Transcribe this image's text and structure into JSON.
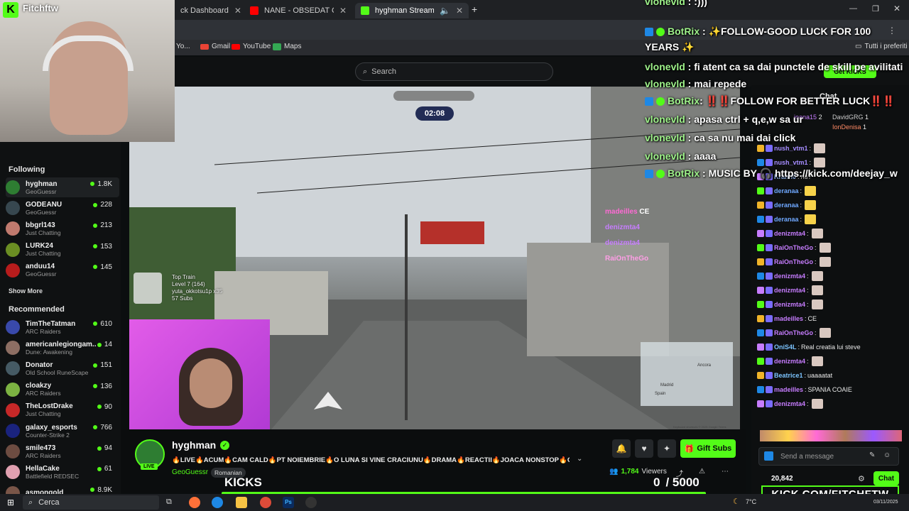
{
  "browser": {
    "tabs": [
      {
        "label": "ck Dashboard",
        "icon": "kick-favicon"
      },
      {
        "label": "NANE - OBSEDAT CA CENTRAL",
        "icon": "youtube-favicon"
      },
      {
        "label": "hyghman Stream - Watch L",
        "icon": "kick-favicon",
        "active": true
      }
    ],
    "new_tab": "+",
    "bookmarks": [
      "Yo...",
      "Gmail",
      "YouTube",
      "Maps"
    ],
    "all_bookmarks": "Tutti i preferiti"
  },
  "webcam_channel": "Fitchftw",
  "search": {
    "placeholder": "Search"
  },
  "sidebar": {
    "following_title": "Following",
    "following": [
      {
        "name": "hyghman",
        "game": "GeoGuessr",
        "viewers": "1.8K",
        "color": "#2e7d32"
      },
      {
        "name": "GODEANU",
        "game": "GeoGuessr",
        "viewers": "228",
        "color": "#37474f"
      },
      {
        "name": "bbgrl143",
        "game": "Just Chatting",
        "viewers": "213",
        "color": "#c07a6e"
      },
      {
        "name": "LURK24",
        "game": "Just Chatting",
        "viewers": "153",
        "color": "#6b8e23"
      },
      {
        "name": "anduu14",
        "game": "GeoGuessr",
        "viewers": "145",
        "color": "#b71c1c"
      }
    ],
    "show_more": "Show More",
    "recommended_title": "Recommended",
    "recommended": [
      {
        "name": "TimTheTatman",
        "game": "ARC Raiders",
        "viewers": "610",
        "color": "#3949ab"
      },
      {
        "name": "americanlegiongam...",
        "game": "Dune: Awakening",
        "viewers": "14",
        "color": "#8d6e63"
      },
      {
        "name": "Donator",
        "game": "Old School RuneScape",
        "viewers": "151",
        "color": "#455a64"
      },
      {
        "name": "cloakzy",
        "game": "ARC Raiders",
        "viewers": "136",
        "color": "#7cb342"
      },
      {
        "name": "TheLostDrake",
        "game": "Just Chatting",
        "viewers": "90",
        "color": "#c62828"
      },
      {
        "name": "galaxy_esports",
        "game": "Counter-Strike 2",
        "viewers": "766",
        "color": "#1a237e"
      },
      {
        "name": "smile473",
        "game": "ARC Raiders",
        "viewers": "94",
        "color": "#6d4c41"
      },
      {
        "name": "HellaCake",
        "game": "Battlefield REDSEC",
        "viewers": "61",
        "color": "#e0a0b0"
      },
      {
        "name": "asmongold",
        "game": "",
        "viewers": "8.9K",
        "color": "#795548"
      }
    ]
  },
  "video": {
    "timer": "02:08",
    "train_overlay": {
      "title": "Top Train",
      "level": "Level 7 (164)",
      "user": "yuta_okkotsu1p x35",
      "subs": "57 Subs"
    },
    "map_labels": [
      "Ancora",
      "Spain",
      "Madrid"
    ],
    "copyright": "Keyboard shortcuts © 2025 Google Terms"
  },
  "stream_info": {
    "streamer": "hyghman",
    "live": "LIVE",
    "title": "🔥LIVE🔥ACUM🔥CAM CALD🔥PT NOIEMBRIE🔥O LUNA SI VINE CRACIUNU🔥DRAMA🔥REACTII🔥JOACA NONSTOP🔥OBS...",
    "category": "GeoGuessr",
    "tag": "Romanian",
    "viewers": "1,784",
    "viewers_label": "Viewers",
    "gift_subs": "Gift Subs"
  },
  "kicks_bar": {
    "label": "KICKS",
    "current": "0",
    "goal": "/ 5000"
  },
  "overlay_chat": [
    {
      "user": "vlonevld",
      "text": " : :)))",
      "color": "#9ef28a"
    },
    {
      "user": "BotRix",
      "text": " : ✨FOLLOW-GOOD LUCK FOR 100",
      "color": "#9ef28a"
    },
    {
      "user": "",
      "text": "YEARS ✨",
      "color": "#fff"
    },
    {
      "user": "vlonevld",
      "text": " : fi atent ca sa dai punctele de skill pe avilitati",
      "color": "#9ef28a"
    },
    {
      "user": "vlonevld",
      "text": " : mai repede",
      "color": "#9ef28a"
    },
    {
      "user": "BotRix",
      "text": ": ‼️‼️FOLLOW FOR BETTER LUCK‼️‼️",
      "color": "#9ef28a"
    },
    {
      "user": "vlonevld",
      "text": " : apasa ctrl + q,e,w sa ur",
      "color": "#9ef28a"
    },
    {
      "user": "vlonevld",
      "text": " : ca sa nu mai dai click",
      "color": "#9ef28a"
    },
    {
      "user": "vlonevld",
      "text": " : aaaa",
      "color": "#9ef28a"
    },
    {
      "user": "BotRix",
      "text": " : MUSIC BY 🎧 https://kick.com/deejay_w",
      "color": "#9ef28a"
    }
  ],
  "overlay_small": [
    {
      "user": "madeilles",
      "text": "CE"
    },
    {
      "user": "denizmta4",
      "text": ""
    },
    {
      "user": "denizmta4",
      "text": ""
    },
    {
      "user": "RaiOnTheGo",
      "text": ""
    }
  ],
  "chat": {
    "header": "Chat",
    "get_kicks": "Get KICKS",
    "top_gifters": [
      {
        "name": "ioana15",
        "count": "2"
      },
      {
        "name": "DavidGRG",
        "count": "1"
      },
      {
        "name": "IonDenisa",
        "count": "1"
      }
    ],
    "messages": [
      {
        "user": "nush_vtm1",
        "text": "",
        "color": "#a58cff",
        "emote": true
      },
      {
        "user": "nush_vtm1",
        "text": "",
        "color": "#a58cff",
        "emote": true
      },
      {
        "user": "Krann0",
        "text": "nu?",
        "color": "#9ec3ff",
        "emote": false
      },
      {
        "user": "deranaa",
        "text": "",
        "color": "#6fa8ff",
        "emote": true
      },
      {
        "user": "deranaa",
        "text": "",
        "color": "#6fa8ff",
        "emote": true
      },
      {
        "user": "deranaa",
        "text": "",
        "color": "#6fa8ff",
        "emote": true
      },
      {
        "user": "denizmta4",
        "text": "",
        "color": "#c77dff",
        "emote": true
      },
      {
        "user": "RaiOnTheGo",
        "text": "",
        "color": "#c77dff",
        "emote": true
      },
      {
        "user": "RaiOnTheGo",
        "text": "",
        "color": "#c77dff",
        "emote": true
      },
      {
        "user": "denizmta4",
        "text": "",
        "color": "#c77dff",
        "emote": true
      },
      {
        "user": "denizmta4",
        "text": "",
        "color": "#c77dff",
        "emote": true
      },
      {
        "user": "denizmta4",
        "text": "",
        "color": "#c77dff",
        "emote": true
      },
      {
        "user": "madeilles",
        "text": "CE",
        "color": "#c77dff",
        "emote": false
      },
      {
        "user": "RaiOnTheGo",
        "text": "",
        "color": "#c77dff",
        "emote": true
      },
      {
        "user": "OniS4L",
        "text": "Real creatia lui steve",
        "color": "#7cc4ff",
        "emote": false
      },
      {
        "user": "denizmta4",
        "text": "",
        "color": "#c77dff",
        "emote": true
      },
      {
        "user": "Beatrice1",
        "text": "uaaaatat",
        "color": "#7cc4ff",
        "emote": false
      },
      {
        "user": "madeilles",
        "text": "SPANIA COAIE",
        "color": "#c77dff",
        "emote": false
      },
      {
        "user": "denizmta4",
        "text": "",
        "color": "#c77dff",
        "emote": true
      }
    ],
    "input_placeholder": "Send a message",
    "points": "20,842",
    "chat_button": "Chat"
  },
  "watermark": "KICK.COM/FITCHFTW",
  "taskbar": {
    "search": "Cerca",
    "temp": "7°C",
    "date": "03/11/2025"
  },
  "colors": {
    "kick_green": "#53fc18",
    "bg": "#0b0e0f"
  }
}
